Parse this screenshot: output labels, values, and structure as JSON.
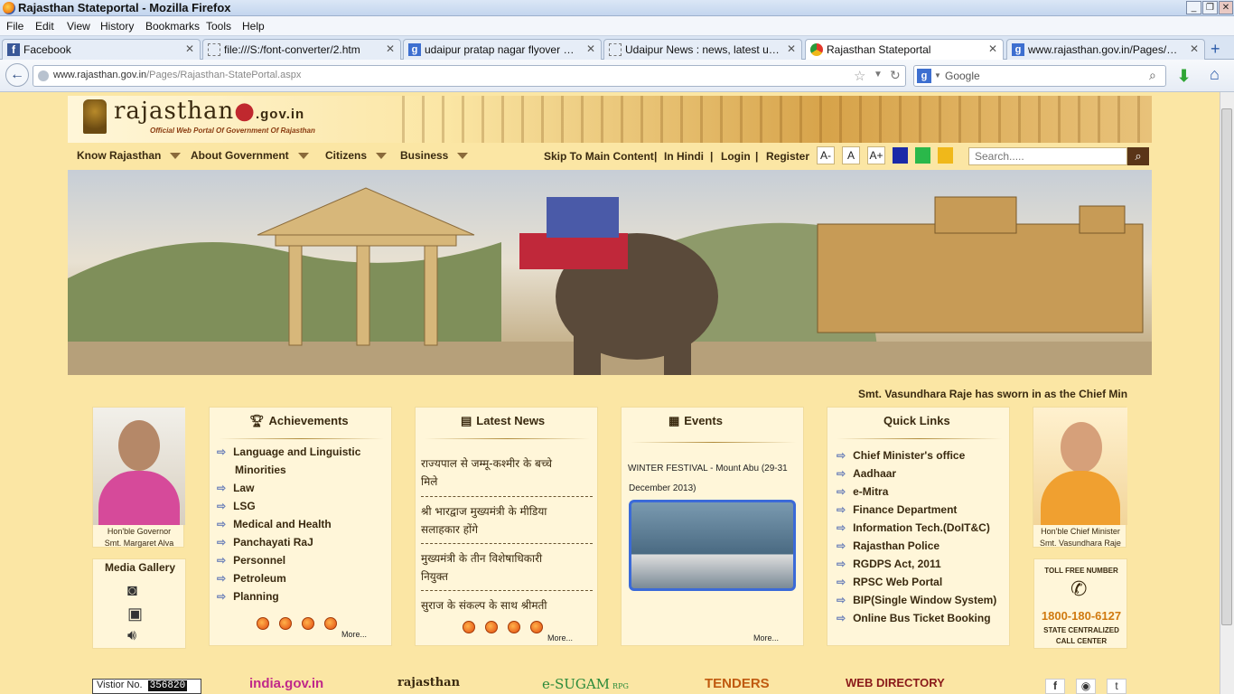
{
  "window": {
    "title": "Rajasthan Stateportal - Mozilla Firefox"
  },
  "menu": [
    "File",
    "Edit",
    "View",
    "History",
    "Bookmarks",
    "Tools",
    "Help"
  ],
  "tabs": [
    {
      "label": "Facebook"
    },
    {
      "label": "file:///S:/font-converter/2.htm"
    },
    {
      "label": "udaipur pratap nagar flyover plan ..."
    },
    {
      "label": "Udaipur News : news, latest updat..."
    },
    {
      "label": "Rajasthan Stateportal"
    },
    {
      "label": "www.rajasthan.gov.in/Pages/Raja..."
    }
  ],
  "url": {
    "host": "www.rajasthan.gov.in",
    "path": "/Pages/Rajasthan-StatePortal.aspx"
  },
  "browser_search": {
    "placeholder": "Google"
  },
  "site": {
    "logo": "rajasthan",
    "logo_suffix": ".gov.in",
    "tagline": "Official Web Portal Of Government Of Rajasthan",
    "nav": [
      "Know Rajasthan",
      "About Government",
      "Citizens",
      "Business"
    ],
    "util": [
      "Skip To Main Content",
      "In Hindi",
      "Login",
      "Register"
    ],
    "font_sizes": [
      "A-",
      "A",
      "A+"
    ],
    "themes": [
      "#1a2aa8",
      "#2ab84a",
      "#f0b81a"
    ],
    "search_placeholder": "Search....."
  },
  "ticker": "Smt. Vasundhara Raje has sworn in as the Chief Min",
  "governor": {
    "caption1": "Hon'ble Governor",
    "caption2": "Smt. Margaret Alva"
  },
  "media_gallery": "Media Gallery",
  "achievements": {
    "title": "Achievements",
    "items": [
      "Language and Linguistic",
      "Minorities",
      "Law",
      "LSG",
      "Medical and Health",
      "Panchayati RaJ",
      "Personnel",
      "Petroleum",
      "Planning"
    ],
    "more": "More..."
  },
  "latest_news": {
    "title": "Latest News",
    "items": [
      {
        "l1": "राज्यपाल से जम्मू-कश्मीर के बच्चे",
        "l2": "मिले"
      },
      {
        "l1": "श्री भारद्वाज मुख्यमंत्री के मीडिया",
        "l2": "सलाहकार होंगे"
      },
      {
        "l1": "मुख्यमंत्री के तीन विशेषाधिकारी",
        "l2": "नियुक्त"
      },
      {
        "l1": "सुराज के संकल्प के साथ श्रीमती",
        "l2": ""
      }
    ],
    "more": "More..."
  },
  "events": {
    "title": "Events",
    "item": "WINTER FESTIVAL - Mount Abu (29-31",
    "item2": "December 2013)",
    "more": "More..."
  },
  "quick_links": {
    "title": "Quick Links",
    "items": [
      "Chief Minister's office",
      "Aadhaar",
      "e-Mitra",
      "Finance Department",
      "Information Tech.(DoIT&C)",
      "Rajasthan Police",
      "RGDPS Act, 2011",
      "RPSC Web Portal",
      "BIP(Single Window System)",
      "Online Bus Ticket Booking"
    ]
  },
  "cm": {
    "caption1": "Hon'ble Chief Minister",
    "caption2": "Smt. Vasundhara Raje"
  },
  "tollfree": {
    "label": "TOLL FREE NUMBER",
    "number": "1800-180-6127",
    "line1": "STATE CENTRALIZED",
    "line2": "CALL CENTER"
  },
  "footer": {
    "visitor_label": "Vistior No.",
    "visitor_count": "356820",
    "logos": [
      "india.gov.in",
      "rajasthan",
      "e-SUGAM",
      "TENDERS",
      "WEB DIRECTORY"
    ],
    "esugam_suffix": "RPG"
  }
}
